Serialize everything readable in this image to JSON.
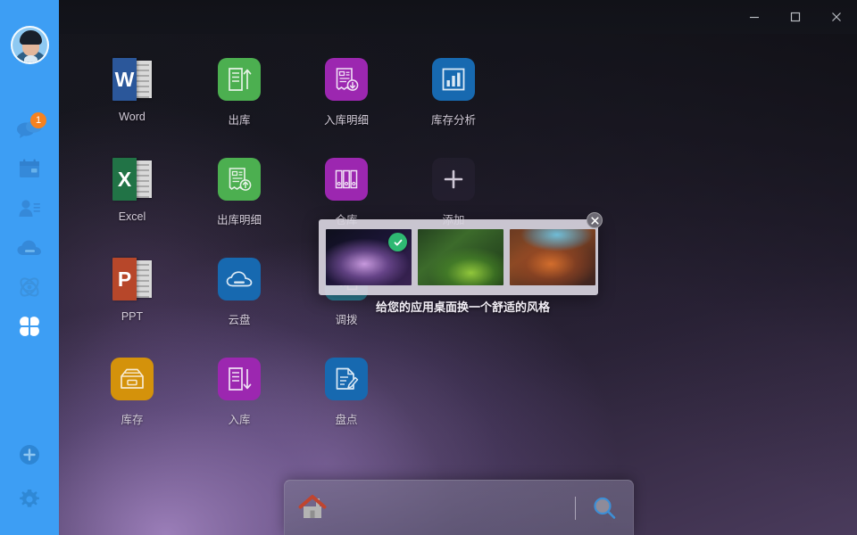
{
  "window": {
    "controls": [
      {
        "name": "minimize",
        "label": "–"
      },
      {
        "name": "maximize",
        "label": "☐"
      },
      {
        "name": "close",
        "label": "✕"
      }
    ]
  },
  "sidebar": {
    "background_color": "#3d9ef4",
    "avatar": {
      "name": "user-avatar"
    },
    "items": [
      {
        "icon": "chat-bubble-icon",
        "badge": "1"
      },
      {
        "icon": "calendar-icon",
        "badge": ""
      },
      {
        "icon": "contacts-icon",
        "badge": ""
      },
      {
        "icon": "cloud-disk-icon",
        "badge": ""
      },
      {
        "icon": "atom-eye-icon",
        "badge": ""
      },
      {
        "icon": "apps-grid-icon",
        "badge": "",
        "active": true
      }
    ],
    "bottom_items": [
      {
        "icon": "add-circle-icon"
      },
      {
        "icon": "settings-gear-icon"
      }
    ],
    "badge_color": "#f58220"
  },
  "apps": [
    {
      "label": "Word",
      "icon": "word-icon",
      "type": "office",
      "color": "#2b579a",
      "letter": "W"
    },
    {
      "label": "出库",
      "icon": "outbound-icon",
      "type": "tile",
      "color": "#4caf50"
    },
    {
      "label": "入库明细",
      "icon": "inbound-detail-icon",
      "type": "tile",
      "color": "#9c27b0"
    },
    {
      "label": "库存分析",
      "icon": "inventory-analysis-icon",
      "type": "tile",
      "color": "#1769b0"
    },
    {
      "label": "Excel",
      "icon": "excel-icon",
      "type": "office",
      "color": "#217346",
      "letter": "X"
    },
    {
      "label": "出库明细",
      "icon": "outbound-detail-icon",
      "type": "tile",
      "color": "#4caf50"
    },
    {
      "label": "仓库",
      "icon": "warehouse-icon",
      "type": "tile",
      "color": "#9c27b0"
    },
    {
      "label": "添加",
      "icon": "add-app-icon",
      "type": "add",
      "color": "rgba(40,34,52,0.55)"
    },
    {
      "label": "PPT",
      "icon": "powerpoint-icon",
      "type": "office",
      "color": "#b7472a",
      "letter": "P"
    },
    {
      "label": "云盘",
      "icon": "cloud-disk-app-icon",
      "type": "tile",
      "color": "#1769b0"
    },
    {
      "label": "调拨",
      "icon": "transfer-icon",
      "type": "tile",
      "color": "#2c7f96"
    },
    {
      "label": "库存",
      "icon": "stock-icon",
      "type": "tile",
      "color": "#d4920b"
    },
    {
      "label": "入库",
      "icon": "inbound-icon",
      "type": "tile",
      "color": "#9c27b0"
    },
    {
      "label": "盘点",
      "icon": "stocktake-icon",
      "type": "tile",
      "color": "#1769b0"
    }
  ],
  "theme_popup": {
    "caption": "给您的应用桌面换一个舒适的风格",
    "close_label": "✕",
    "background_color": "#d6d2dd",
    "check_color": "#2eb872",
    "thumbnails": [
      {
        "name": "theme-purple-nebula",
        "selected": true
      },
      {
        "name": "theme-green-leaf",
        "selected": false
      },
      {
        "name": "theme-orange-bloom",
        "selected": false
      }
    ]
  },
  "searchbar": {
    "home_label": "home-icon",
    "search_label": "search-icon",
    "input_value": "",
    "input_placeholder": ""
  }
}
